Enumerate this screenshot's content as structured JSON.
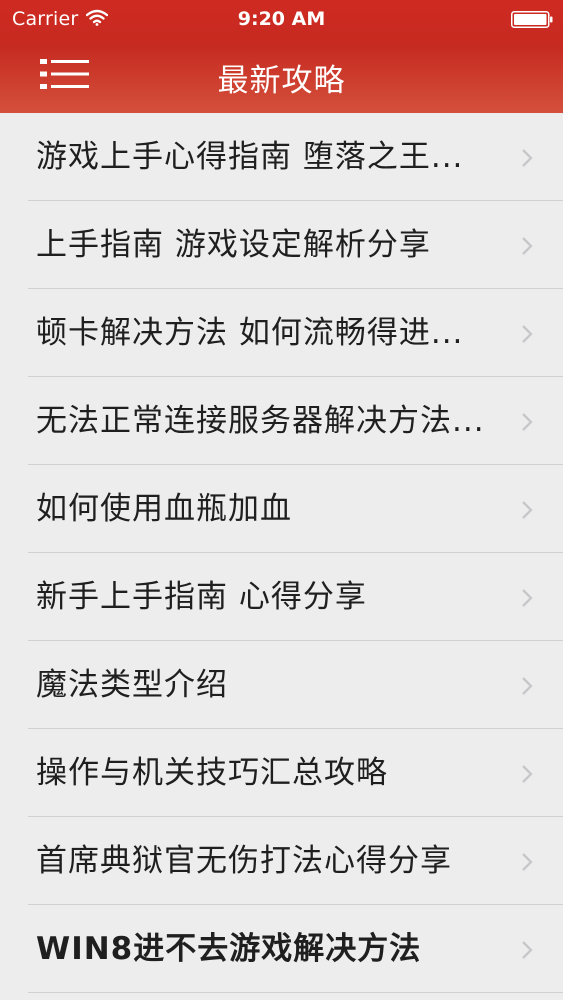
{
  "status_bar": {
    "carrier": "Carrier",
    "time": "9:20 AM",
    "wifi_icon": "wifi-icon",
    "battery_icon": "battery-icon"
  },
  "nav": {
    "title": "最新攻略",
    "menu_icon": "hamburger-menu-icon",
    "background_color": "#c92b22"
  },
  "list": {
    "items": [
      {
        "label": "游戏上手心得指南 堕落之王..."
      },
      {
        "label": "上手指南 游戏设定解析分享"
      },
      {
        "label": "顿卡解决方法 如何流畅得进..."
      },
      {
        "label": "无法正常连接服务器解决方法..."
      },
      {
        "label": "如何使用血瓶加血"
      },
      {
        "label": "新手上手指南 心得分享"
      },
      {
        "label": "魔法类型介绍"
      },
      {
        "label": "操作与机关技巧汇总攻略"
      },
      {
        "label": "首席典狱官无伤打法心得分享"
      },
      {
        "label": "WIN8进不去游戏解决方法"
      }
    ],
    "chevron_icon": "chevron-right-icon",
    "chevron_color": "#c7c7cc",
    "background_color": "#eeeded"
  }
}
